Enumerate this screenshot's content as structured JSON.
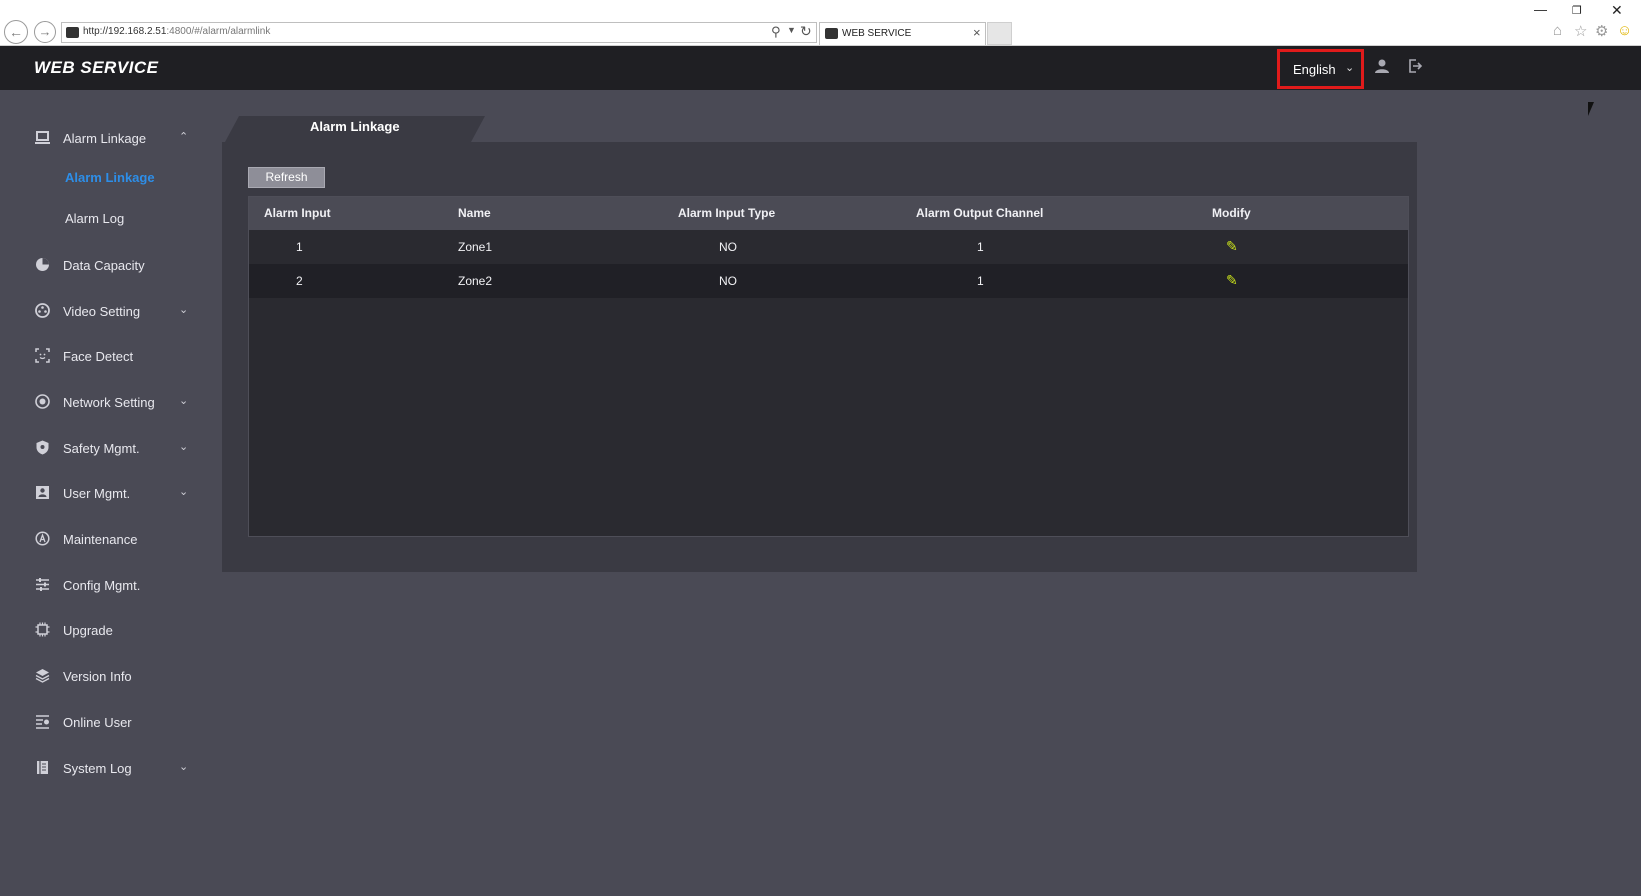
{
  "browser": {
    "url_host": "http://192.168.2.51",
    "url_path": ":4800/#/alarm/alarmlink",
    "tab_title": "WEB SERVICE"
  },
  "header": {
    "title": "WEB SERVICE",
    "language": "English"
  },
  "sidebar": {
    "items": [
      {
        "label": "Alarm Linkage",
        "icon": "alarm-linkage-icon",
        "expanded": true
      },
      {
        "label": "Data Capacity",
        "icon": "pie-chart-icon"
      },
      {
        "label": "Video Setting",
        "icon": "video-setting-icon"
      },
      {
        "label": "Face Detect",
        "icon": "face-detect-icon"
      },
      {
        "label": "Network Setting",
        "icon": "network-icon"
      },
      {
        "label": "Safety Mgmt.",
        "icon": "shield-icon"
      },
      {
        "label": "User Mgmt.",
        "icon": "user-card-icon"
      },
      {
        "label": "Maintenance",
        "icon": "maintenance-icon"
      },
      {
        "label": "Config Mgmt.",
        "icon": "sliders-icon"
      },
      {
        "label": "Upgrade",
        "icon": "chip-icon"
      },
      {
        "label": "Version Info",
        "icon": "layers-icon"
      },
      {
        "label": "Online User",
        "icon": "online-user-icon"
      },
      {
        "label": "System Log",
        "icon": "log-book-icon"
      }
    ],
    "sub_items": [
      {
        "label": "Alarm Linkage",
        "active": true
      },
      {
        "label": "Alarm Log",
        "active": false
      }
    ]
  },
  "main": {
    "tab_label": "Alarm Linkage",
    "refresh_label": "Refresh",
    "columns": [
      "Alarm Input",
      "Name",
      "Alarm Input Type",
      "Alarm Output Channel",
      "Modify"
    ],
    "rows": [
      {
        "alarm_input": "1",
        "name": "Zone1",
        "input_type": "NO",
        "output_channel": "1"
      },
      {
        "alarm_input": "2",
        "name": "Zone2",
        "input_type": "NO",
        "output_channel": "1"
      }
    ],
    "accent_color": "#2d8ee8",
    "edit_icon_color": "#c8e01c",
    "highlight_color": "#e01b1b"
  }
}
